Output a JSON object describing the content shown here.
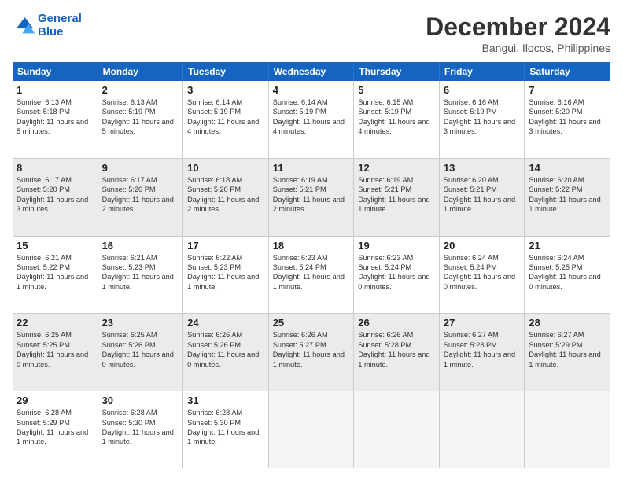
{
  "logo": {
    "line1": "General",
    "line2": "Blue"
  },
  "title": "December 2024",
  "subtitle": "Bangui, Ilocos, Philippines",
  "days": [
    "Sunday",
    "Monday",
    "Tuesday",
    "Wednesday",
    "Thursday",
    "Friday",
    "Saturday"
  ],
  "weeks": [
    [
      {
        "num": "1",
        "rise": "6:13 AM",
        "set": "5:18 PM",
        "daylight": "11 hours and 5 minutes."
      },
      {
        "num": "2",
        "rise": "6:13 AM",
        "set": "5:19 PM",
        "daylight": "11 hours and 5 minutes."
      },
      {
        "num": "3",
        "rise": "6:14 AM",
        "set": "5:19 PM",
        "daylight": "11 hours and 4 minutes."
      },
      {
        "num": "4",
        "rise": "6:14 AM",
        "set": "5:19 PM",
        "daylight": "11 hours and 4 minutes."
      },
      {
        "num": "5",
        "rise": "6:15 AM",
        "set": "5:19 PM",
        "daylight": "11 hours and 4 minutes."
      },
      {
        "num": "6",
        "rise": "6:16 AM",
        "set": "5:19 PM",
        "daylight": "11 hours and 3 minutes."
      },
      {
        "num": "7",
        "rise": "6:16 AM",
        "set": "5:20 PM",
        "daylight": "11 hours and 3 minutes."
      }
    ],
    [
      {
        "num": "8",
        "rise": "6:17 AM",
        "set": "5:20 PM",
        "daylight": "11 hours and 3 minutes."
      },
      {
        "num": "9",
        "rise": "6:17 AM",
        "set": "5:20 PM",
        "daylight": "11 hours and 2 minutes."
      },
      {
        "num": "10",
        "rise": "6:18 AM",
        "set": "5:20 PM",
        "daylight": "11 hours and 2 minutes."
      },
      {
        "num": "11",
        "rise": "6:19 AM",
        "set": "5:21 PM",
        "daylight": "11 hours and 2 minutes."
      },
      {
        "num": "12",
        "rise": "6:19 AM",
        "set": "5:21 PM",
        "daylight": "11 hours and 1 minute."
      },
      {
        "num": "13",
        "rise": "6:20 AM",
        "set": "5:21 PM",
        "daylight": "11 hours and 1 minute."
      },
      {
        "num": "14",
        "rise": "6:20 AM",
        "set": "5:22 PM",
        "daylight": "11 hours and 1 minute."
      }
    ],
    [
      {
        "num": "15",
        "rise": "6:21 AM",
        "set": "5:22 PM",
        "daylight": "11 hours and 1 minute."
      },
      {
        "num": "16",
        "rise": "6:21 AM",
        "set": "5:23 PM",
        "daylight": "11 hours and 1 minute."
      },
      {
        "num": "17",
        "rise": "6:22 AM",
        "set": "5:23 PM",
        "daylight": "11 hours and 1 minute."
      },
      {
        "num": "18",
        "rise": "6:23 AM",
        "set": "5:24 PM",
        "daylight": "11 hours and 1 minute."
      },
      {
        "num": "19",
        "rise": "6:23 AM",
        "set": "5:24 PM",
        "daylight": "11 hours and 0 minutes."
      },
      {
        "num": "20",
        "rise": "6:24 AM",
        "set": "5:24 PM",
        "daylight": "11 hours and 0 minutes."
      },
      {
        "num": "21",
        "rise": "6:24 AM",
        "set": "5:25 PM",
        "daylight": "11 hours and 0 minutes."
      }
    ],
    [
      {
        "num": "22",
        "rise": "6:25 AM",
        "set": "5:25 PM",
        "daylight": "11 hours and 0 minutes."
      },
      {
        "num": "23",
        "rise": "6:25 AM",
        "set": "5:26 PM",
        "daylight": "11 hours and 0 minutes."
      },
      {
        "num": "24",
        "rise": "6:26 AM",
        "set": "5:26 PM",
        "daylight": "11 hours and 0 minutes."
      },
      {
        "num": "25",
        "rise": "6:26 AM",
        "set": "5:27 PM",
        "daylight": "11 hours and 1 minute."
      },
      {
        "num": "26",
        "rise": "6:26 AM",
        "set": "5:28 PM",
        "daylight": "11 hours and 1 minute."
      },
      {
        "num": "27",
        "rise": "6:27 AM",
        "set": "5:28 PM",
        "daylight": "11 hours and 1 minute."
      },
      {
        "num": "28",
        "rise": "6:27 AM",
        "set": "5:29 PM",
        "daylight": "11 hours and 1 minute."
      }
    ],
    [
      {
        "num": "29",
        "rise": "6:28 AM",
        "set": "5:29 PM",
        "daylight": "11 hours and 1 minute."
      },
      {
        "num": "30",
        "rise": "6:28 AM",
        "set": "5:30 PM",
        "daylight": "11 hours and 1 minute."
      },
      {
        "num": "31",
        "rise": "6:28 AM",
        "set": "5:30 PM",
        "daylight": "11 hours and 1 minute."
      },
      null,
      null,
      null,
      null
    ]
  ]
}
